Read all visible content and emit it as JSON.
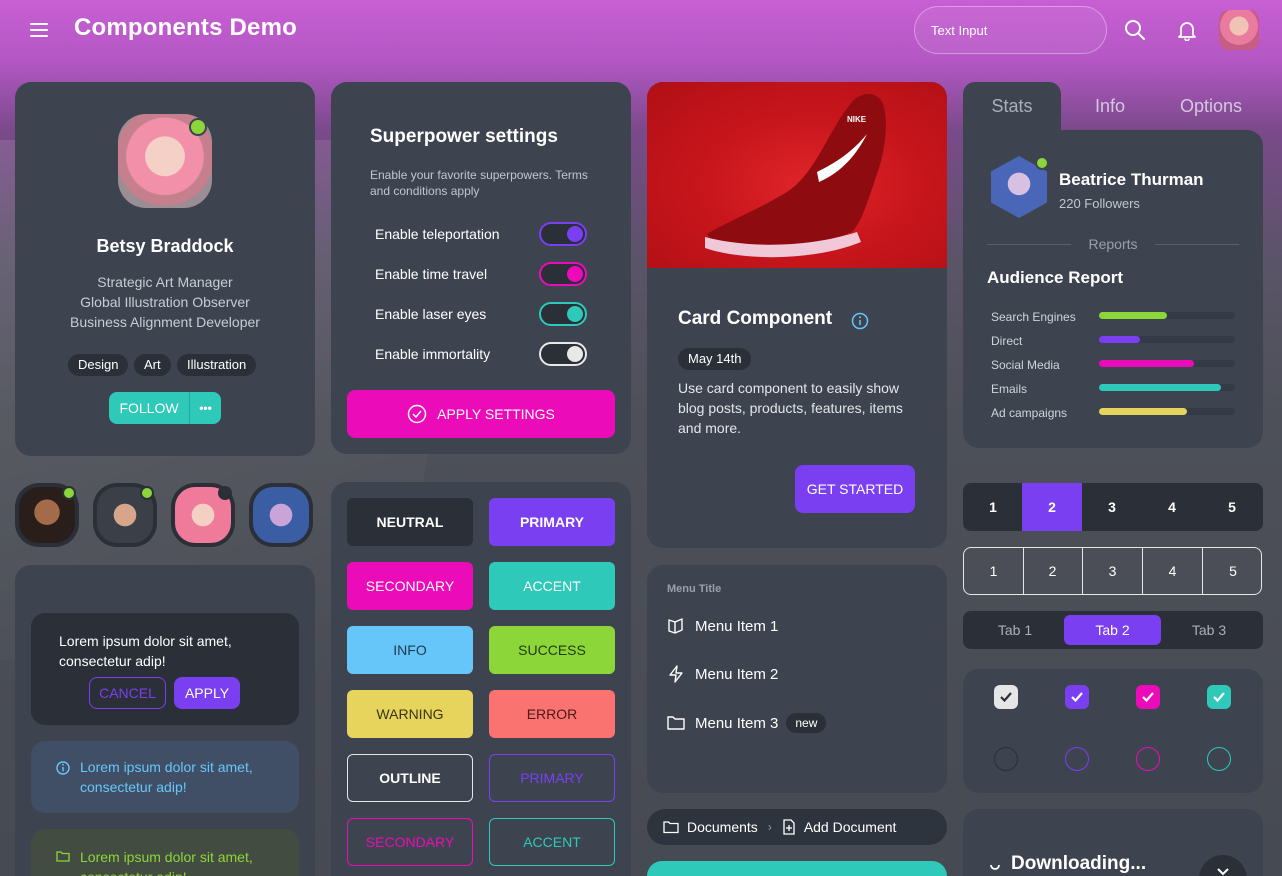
{
  "header": {
    "title": "Components Demo",
    "input_placeholder": "Text Input"
  },
  "profile": {
    "name": "Betsy Braddock",
    "roles": [
      "Strategic Art Manager",
      "Global Illustration Observer",
      "Business Alignment Developer"
    ],
    "tags": [
      "Design",
      "Art",
      "Illustration"
    ],
    "follow_label": "FOLLOW",
    "more_label": "•••"
  },
  "superpower": {
    "title": "Superpower settings",
    "desc_line1": "Enable your favorite superpowers. Terms",
    "desc_line2": "and conditions apply",
    "toggles": [
      {
        "label": "Enable teleportation",
        "color": "#7b3ff2"
      },
      {
        "label": "Enable time travel",
        "color": "#ec0bb8"
      },
      {
        "label": "Enable laser eyes",
        "color": "#2ec9b8"
      },
      {
        "label": "Enable immortality",
        "color": "#e8e8e8"
      }
    ],
    "apply_label": "APPLY SETTINGS"
  },
  "card_component": {
    "title": "Card Component",
    "date": "May 14th",
    "text_line1": "Use card component to easily show",
    "text_line2": "blog posts, products, features, items",
    "text_line3": "and more.",
    "cta": "GET STARTED"
  },
  "tabs_top": [
    "Stats",
    "Info",
    "Options"
  ],
  "stats": {
    "name": "Beatrice Thurman",
    "followers": "220 Followers",
    "divider_label": "Reports",
    "report_title": "Audience Report",
    "rows": [
      {
        "label": "Search Engines",
        "value": 0.5,
        "color": "#8cd63a"
      },
      {
        "label": "Direct",
        "value": 0.3,
        "color": "#7b3ff2"
      },
      {
        "label": "Social Media",
        "value": 0.7,
        "color": "#ec0bb8"
      },
      {
        "label": "Emails",
        "value": 0.9,
        "color": "#2ec9b8"
      },
      {
        "label": "Ad campaigns",
        "value": 0.65,
        "color": "#e6d45c"
      }
    ]
  },
  "alert": {
    "text_line1": "Lorem ipsum dolor sit amet,",
    "text_line2": "consectetur adip!",
    "cancel": "CANCEL",
    "apply": "APPLY"
  },
  "info_alert": {
    "line1": "Lorem ipsum dolor sit amet,",
    "line2": "consectetur adip!"
  },
  "success_alert": {
    "line1": "Lorem ipsum dolor sit amet,",
    "line2": "consectetur adip!"
  },
  "buttons": [
    {
      "label": "NEUTRAL"
    },
    {
      "label": "PRIMARY"
    },
    {
      "label": "SECONDARY"
    },
    {
      "label": "ACCENT"
    },
    {
      "label": "INFO"
    },
    {
      "label": "SUCCESS"
    },
    {
      "label": "WARNING"
    },
    {
      "label": "ERROR"
    },
    {
      "label": "OUTLINE"
    },
    {
      "label": "PRIMARY"
    },
    {
      "label": "SECONDARY"
    },
    {
      "label": "ACCENT"
    }
  ],
  "menu": {
    "title": "Menu Title",
    "items": [
      "Menu Item 1",
      "Menu Item 2",
      "Menu Item 3"
    ],
    "badge": "new"
  },
  "breadcrumb": {
    "first": "Documents",
    "second": "Add Document"
  },
  "pagination": [
    "1",
    "2",
    "3",
    "4",
    "5"
  ],
  "pagination_active": "2",
  "tabs_small": [
    "Tab 1",
    "Tab 2",
    "Tab 3"
  ],
  "download": {
    "label": "Downloading..."
  },
  "colors": {
    "primary": "#7b3ff2",
    "secondary": "#ec0bb8",
    "accent": "#2ec9b8",
    "neutral": "#2a2f38",
    "info": "#66c6f9",
    "success": "#8cd63a",
    "warning": "#e6d45c",
    "error": "#fb7370",
    "card": "#3d4450"
  }
}
